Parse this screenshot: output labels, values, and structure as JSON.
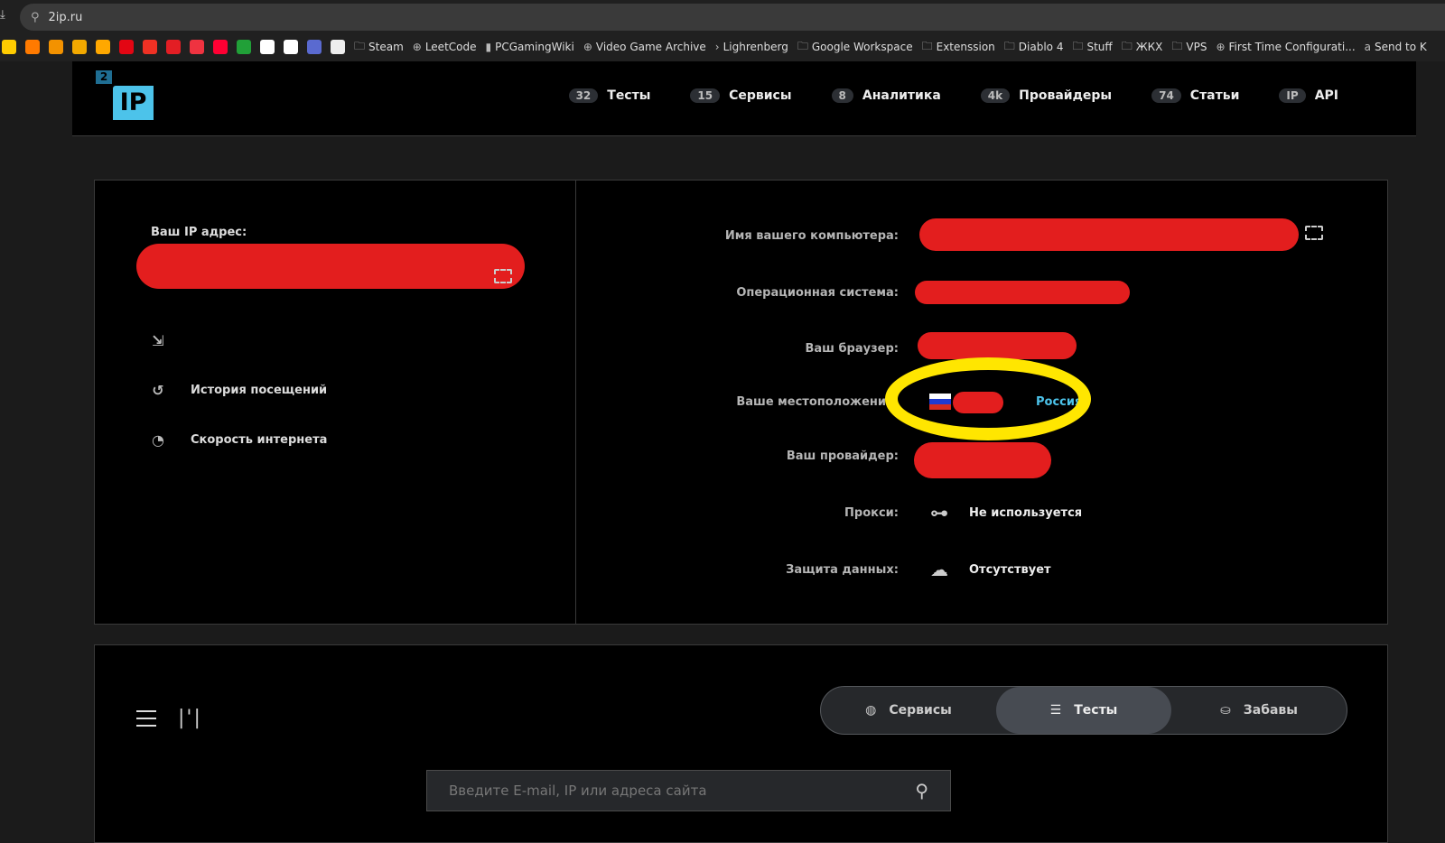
{
  "browser": {
    "url": "2ip.ru"
  },
  "bookmarks": {
    "favicons": [
      {
        "color": "#ffcc00"
      },
      {
        "color": "#ff7a00"
      },
      {
        "color": "#f39200"
      },
      {
        "color": "#f2a900"
      },
      {
        "color": "#ffa800"
      },
      {
        "color": "#e30613"
      },
      {
        "color": "#ef3124"
      },
      {
        "color": "#e31e24"
      },
      {
        "color": "#ef3340"
      },
      {
        "color": "#ff0033"
      },
      {
        "color": "#21a038"
      },
      {
        "color": "#ffffff"
      },
      {
        "color": "#ffffff"
      },
      {
        "color": "#5a6ad0"
      },
      {
        "color": "#eeeeee"
      }
    ],
    "items": [
      {
        "label": "Steam",
        "icon": "folder-icon"
      },
      {
        "label": "LeetCode",
        "icon": "globe-icon"
      },
      {
        "label": "PCGamingWiki",
        "icon": "pcgw-icon"
      },
      {
        "label": "Video Game Archive",
        "icon": "globe-icon"
      },
      {
        "label": "Lighrenberg",
        "icon": "chevron-icon"
      },
      {
        "label": "Google Workspace",
        "icon": "folder-icon"
      },
      {
        "label": "Extenssion",
        "icon": "folder-icon"
      },
      {
        "label": "Diablo 4",
        "icon": "folder-icon"
      },
      {
        "label": "Stuff",
        "icon": "folder-icon"
      },
      {
        "label": "ЖКХ",
        "icon": "folder-icon"
      },
      {
        "label": "VPS",
        "icon": "folder-icon"
      },
      {
        "label": "First Time Configurati...",
        "icon": "globe-icon"
      },
      {
        "label": "Send to K",
        "icon": "amazon-icon"
      }
    ]
  },
  "header": {
    "logo": {
      "small": "2",
      "big": "IP"
    },
    "nav": [
      {
        "badge": "32",
        "label": "Тесты"
      },
      {
        "badge": "15",
        "label": "Сервисы"
      },
      {
        "badge": "8",
        "label": "Аналитика"
      },
      {
        "badge": "4k",
        "label": "Провайдеры"
      },
      {
        "badge": "74",
        "label": "Статьи"
      },
      {
        "badge": "IP",
        "label": "API"
      }
    ]
  },
  "ip_panel": {
    "label": "Ваш IP адрес:",
    "links": [
      {
        "label": "",
        "icon": "redirect-icon"
      },
      {
        "label": "История посещений",
        "icon": "history-icon"
      },
      {
        "label": "Скорость интернета",
        "icon": "speedometer-icon"
      }
    ]
  },
  "info": {
    "rows": [
      {
        "label": "Имя вашего компьютера:",
        "value": ""
      },
      {
        "label": "Операционная система:",
        "value": ""
      },
      {
        "label": "Ваш браузер:",
        "value": ""
      },
      {
        "label": "Ваше местоположение:",
        "value": "Россия",
        "flag": "ru"
      },
      {
        "label": "Ваш провайдер:",
        "value": ""
      },
      {
        "label": "Прокси:",
        "value": "Не используется",
        "icon": "network-icon"
      },
      {
        "label": "Защита данных:",
        "value": "Отсутствует",
        "icon": "cloud-lock-icon"
      }
    ],
    "accent": "#4cc3ea"
  },
  "bottom": {
    "segments": [
      {
        "label": "Сервисы",
        "icon": "globe-icon",
        "active": false
      },
      {
        "label": "Тесты",
        "icon": "list-icon",
        "active": true
      },
      {
        "label": "Забавы",
        "icon": "toy-icon",
        "active": false
      }
    ],
    "search": {
      "placeholder": "Введите E-mail, IP или адреса сайта",
      "value": ""
    }
  }
}
